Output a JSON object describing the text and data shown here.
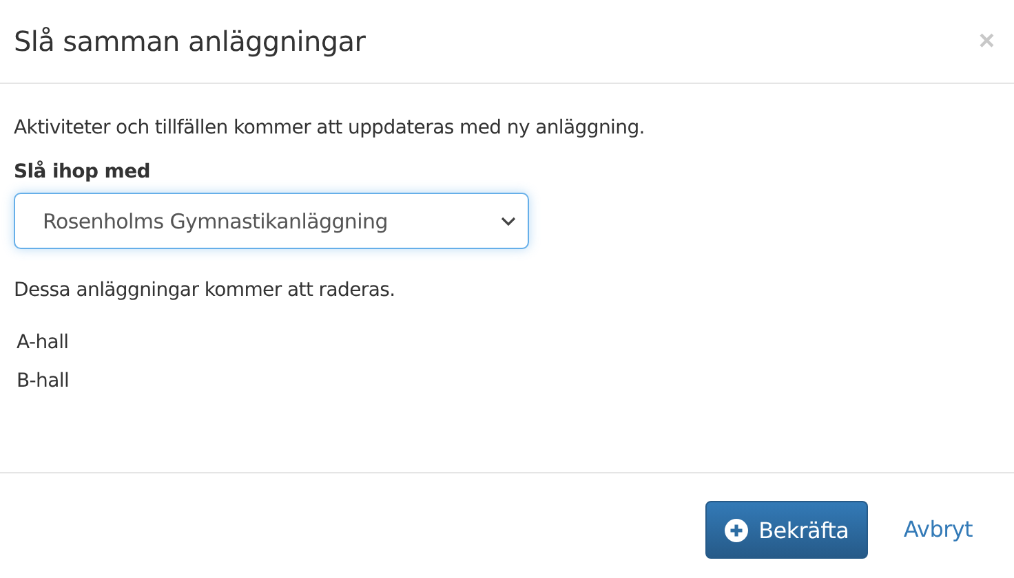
{
  "dialog": {
    "title": "Slå samman anläggningar",
    "close": "×"
  },
  "body": {
    "info": "Aktiviteter och tillfällen kommer att uppdateras med ny anläggning.",
    "merge_label": "Slå ihop med",
    "select": {
      "value": "Rosenholms Gymnastikanläggning",
      "focused": true
    },
    "delete_info": "Dessa anläggningar kommer att raderas.",
    "deleted": [
      "A-hall",
      "B-hall"
    ]
  },
  "footer": {
    "confirm": "Bekräfta",
    "cancel": "Avbryt"
  }
}
